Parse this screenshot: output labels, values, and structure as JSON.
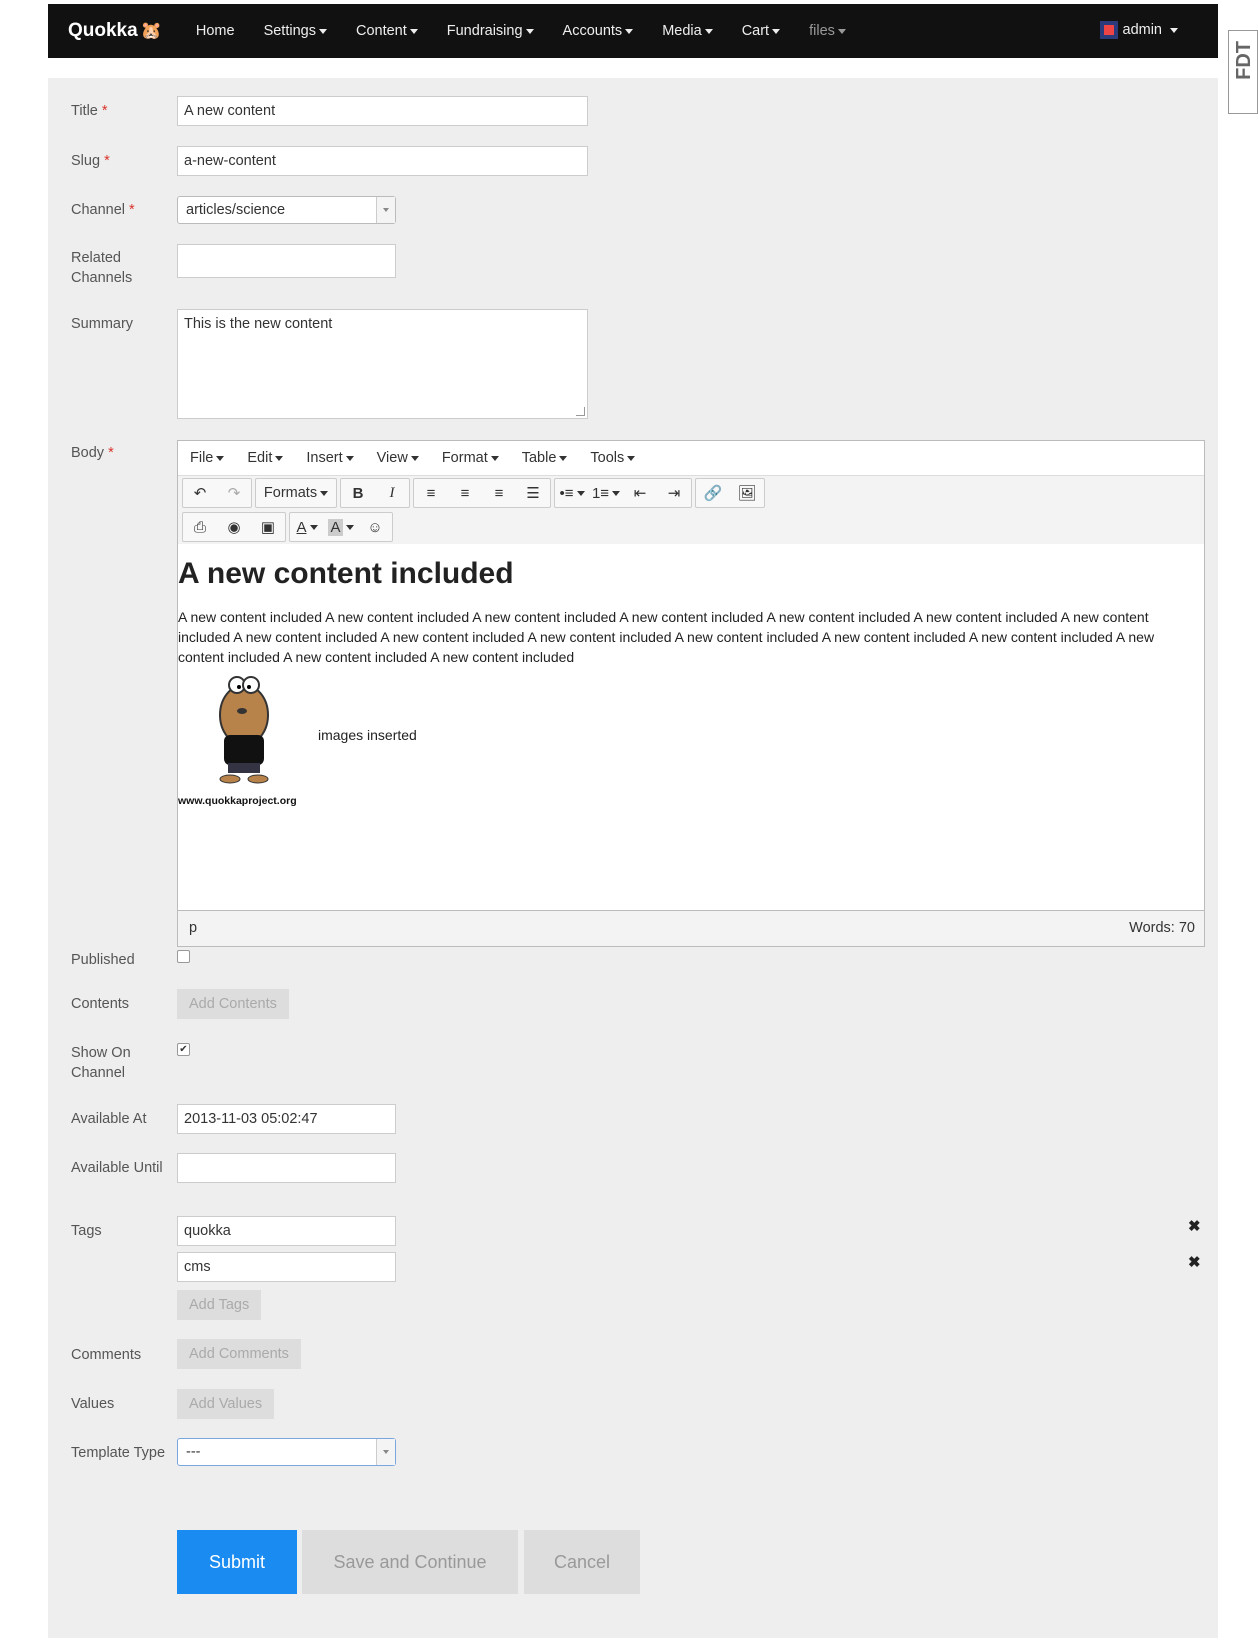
{
  "navbar": {
    "brand": "Quokka",
    "items": [
      {
        "label": "Home",
        "dropdown": false
      },
      {
        "label": "Settings",
        "dropdown": true
      },
      {
        "label": "Content",
        "dropdown": true
      },
      {
        "label": "Fundraising",
        "dropdown": true
      },
      {
        "label": "Accounts",
        "dropdown": true
      },
      {
        "label": "Media",
        "dropdown": true
      },
      {
        "label": "Cart",
        "dropdown": true
      },
      {
        "label": "files",
        "dropdown": true
      }
    ],
    "user": "admin"
  },
  "sidetab": "FDT",
  "form": {
    "title": {
      "label": "Title",
      "value": "A new content"
    },
    "slug": {
      "label": "Slug",
      "value": "a-new-content"
    },
    "channel": {
      "label": "Channel",
      "value": "articles/science"
    },
    "related_channels": {
      "label_line1": "Related",
      "label_line2": "Channels",
      "value": ""
    },
    "summary": {
      "label": "Summary",
      "value": "This is the new content"
    },
    "body": {
      "label": "Body"
    },
    "published": {
      "label": "Published",
      "checked": false
    },
    "contents": {
      "label": "Contents",
      "button": "Add Contents"
    },
    "show_on_channel": {
      "label_line1": "Show On",
      "label_line2": "Channel",
      "checked": true,
      "check_mark": "✔"
    },
    "available_at": {
      "label": "Available At",
      "value": "2013-11-03 05:02:47"
    },
    "available_until": {
      "label": "Available Until",
      "value": ""
    },
    "tags": {
      "label": "Tags",
      "values": [
        "quokka",
        "cms"
      ],
      "button": "Add Tags"
    },
    "comments": {
      "label": "Comments",
      "button": "Add Comments"
    },
    "values": {
      "label": "Values",
      "button": "Add Values"
    },
    "template_type": {
      "label": "Template Type",
      "value": "---"
    },
    "required_mark": "*",
    "remove_glyph": "✖"
  },
  "editor": {
    "menus": [
      "File",
      "Edit",
      "Insert",
      "View",
      "Format",
      "Table",
      "Tools"
    ],
    "formats_label": "Formats",
    "heading": "A new content included",
    "paragraph": "A new content included A new content included A new content included A new content included A new content included A new content included A new content included A new content included A new content included A new content included A new content included A new content included A new content included A new content included A new content included A new content included",
    "image_caption": "images inserted",
    "image_site": "www.quokkaproject.org",
    "status_path": "p",
    "word_count": "Words: 70"
  },
  "buttons": {
    "submit": "Submit",
    "save": "Save and Continue",
    "cancel": "Cancel"
  },
  "colors": {
    "primary": "#1a8bf0",
    "navbar": "#111111",
    "required": "#d9342b"
  }
}
